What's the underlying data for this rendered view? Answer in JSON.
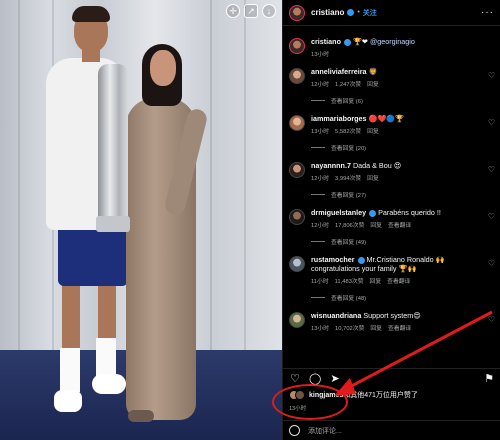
{
  "post": {
    "username": "cristiano",
    "follow_label": "关注",
    "caption": {
      "username": "cristiano",
      "mention": "@georginagio",
      "emojis": "🏆❤",
      "time": "13小时"
    }
  },
  "comments": [
    {
      "user": "anneliviaferreira",
      "text": "🦁",
      "time": "12小时",
      "likes": "1,247次赞",
      "reply": "回复",
      "replies": "查看回复 (6)"
    },
    {
      "user": "iammariaborges",
      "text": "🔴❤️🔵🏆",
      "time": "13小时",
      "likes": "5,582次赞",
      "reply": "回复",
      "replies": "查看回复 (20)"
    },
    {
      "user": "nayannnn.7",
      "text": "Dada & Bou 😍",
      "time": "12小时",
      "likes": "3,994次赞",
      "reply": "回复",
      "replies": "查看回复 (27)"
    },
    {
      "user": "drmiguelstanley",
      "text": "Parabéns querido !!",
      "time": "12小时",
      "likes": "17,806次赞",
      "reply": "回复",
      "translate": "查看翻译",
      "replies": "查看回复 (49)"
    },
    {
      "user": "rustamocher",
      "text": "Mr.Cristiano Ronaldo 🙌 congratulations your family 🏆🙌",
      "time": "11小时",
      "likes": "11,483次赞",
      "reply": "回复",
      "translate": "查看翻译",
      "replies": "查看回复 (48)"
    },
    {
      "user": "wisnuandriana",
      "text": "Support system😍",
      "time": "13小时",
      "likes": "10,702次赞",
      "reply": "回复",
      "translate": "查看翻译",
      "replies": ""
    }
  ],
  "likes_line": {
    "user": "kingjames",
    "rest": "和其他471万位用户赞了"
  },
  "post_time": "13小时",
  "add_comment_placeholder": "添加评论...",
  "colors": {
    "accent": "#3897f0",
    "annotation": "#e11b1b"
  }
}
